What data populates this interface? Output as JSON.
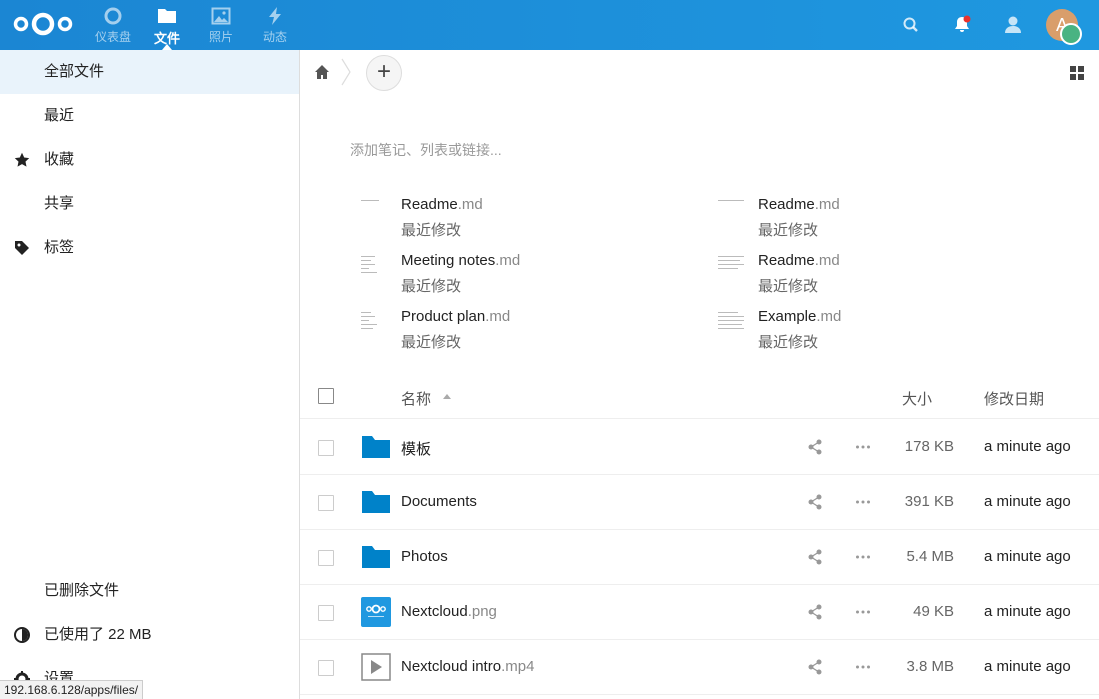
{
  "header": {
    "apps": [
      {
        "label": "仪表盘",
        "icon": "dashboard-icon"
      },
      {
        "label": "文件",
        "icon": "folder-icon"
      },
      {
        "label": "照片",
        "icon": "photos-icon"
      },
      {
        "label": "动态",
        "icon": "activity-icon"
      }
    ],
    "avatar_letter": "A",
    "accent": "#1e8fd8"
  },
  "sidebar": {
    "items": [
      {
        "label": "全部文件"
      },
      {
        "label": "最近"
      },
      {
        "label": "收藏",
        "icon": "star-icon"
      },
      {
        "label": "共享"
      },
      {
        "label": "标签",
        "icon": "tag-icon"
      }
    ],
    "bottom": {
      "deleted": "已删除文件",
      "quota": "已使用了 22 MB",
      "settings": "设置"
    }
  },
  "main": {
    "notes_placeholder": "添加笔记、列表或链接...",
    "recent": [
      {
        "name": "Readme",
        "ext": ".md",
        "sub": "最近修改"
      },
      {
        "name": "Readme",
        "ext": ".md",
        "sub": "最近修改"
      },
      {
        "name": "Meeting notes",
        "ext": ".md",
        "sub": "最近修改"
      },
      {
        "name": "Readme",
        "ext": ".md",
        "sub": "最近修改"
      },
      {
        "name": "Product plan",
        "ext": ".md",
        "sub": "最近修改"
      },
      {
        "name": "Example",
        "ext": ".md",
        "sub": "最近修改"
      }
    ],
    "columns": {
      "name": "名称",
      "size": "大小",
      "modified": "修改日期"
    },
    "files": [
      {
        "name": "模板",
        "ext": "",
        "type": "folder",
        "size": "178 KB",
        "modified": "a minute ago"
      },
      {
        "name": "Documents",
        "ext": "",
        "type": "folder",
        "size": "391 KB",
        "modified": "a minute ago"
      },
      {
        "name": "Photos",
        "ext": "",
        "type": "folder",
        "size": "5.4 MB",
        "modified": "a minute ago"
      },
      {
        "name": "Nextcloud",
        "ext": ".png",
        "type": "image",
        "size": "49 KB",
        "modified": "a minute ago"
      },
      {
        "name": "Nextcloud intro",
        "ext": ".mp4",
        "type": "video",
        "size": "3.8 MB",
        "modified": "a minute ago"
      }
    ]
  },
  "status_url": "192.168.6.128/apps/files/"
}
